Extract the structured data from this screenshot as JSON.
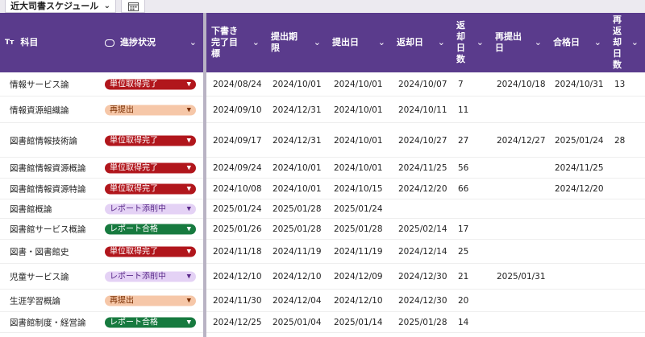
{
  "view": {
    "tab_label": "近大司書スケジュール",
    "tab_chevron": "⌄"
  },
  "colors": {
    "header_bg": "#5a3b8c",
    "status": {
      "単位取得完了": "#b1161c",
      "再提出": "#f6c7a8",
      "レポート添削中": "#e4d2f5",
      "レポート合格": "#177a3f"
    }
  },
  "columns": [
    {
      "key": "subject",
      "label": "科目",
      "icon": "text-type-icon",
      "icon_text": "Tт"
    },
    {
      "key": "status",
      "label": "進捗状況",
      "icon": "select-type-icon"
    },
    {
      "key": "target",
      "label": "下書き\n完了目\n標"
    },
    {
      "key": "deadline",
      "label": "提出期\n限"
    },
    {
      "key": "submitted",
      "label": "提出日"
    },
    {
      "key": "returned",
      "label": "返却日"
    },
    {
      "key": "return_days",
      "label": "返\n却\n日\n数"
    },
    {
      "key": "resubmit",
      "label": "再提出\n日"
    },
    {
      "key": "passed",
      "label": "合格日"
    },
    {
      "key": "re_return_days",
      "label": "再\n返\n却\n日\n数"
    }
  ],
  "rows": [
    {
      "subject": "情報サービス論",
      "status": "単位取得完了",
      "target": "2024/08/24",
      "deadline": "2024/10/01",
      "submitted": "2024/10/01",
      "returned": "2024/10/07",
      "return_days": "7",
      "resubmit": "2024/10/18",
      "passed": "2024/10/31",
      "re_return_days": "13"
    },
    {
      "subject": "情報資源組織論",
      "status": "再提出",
      "target": "2024/09/10",
      "deadline": "2024/12/31",
      "submitted": "2024/10/01",
      "returned": "2024/10/11",
      "return_days": "11",
      "resubmit": "",
      "passed": "",
      "re_return_days": ""
    },
    {
      "subject": "図書館情報技術論",
      "status": "単位取得完了",
      "target": "2024/09/17",
      "deadline": "2024/12/31",
      "submitted": "2024/10/01",
      "returned": "2024/10/27",
      "return_days": "27",
      "resubmit": "2024/12/27",
      "passed": "2025/01/24",
      "re_return_days": "28"
    },
    {
      "subject": "図書館情報資源概論",
      "status": "単位取得完了",
      "target": "2024/09/24",
      "deadline": "2024/10/01",
      "submitted": "2024/10/01",
      "returned": "2024/11/25",
      "return_days": "56",
      "resubmit": "",
      "passed": "2024/11/25",
      "re_return_days": ""
    },
    {
      "subject": "図書館情報資源特論",
      "status": "単位取得完了",
      "target": "2024/10/08",
      "deadline": "2024/10/01",
      "submitted": "2024/10/15",
      "returned": "2024/12/20",
      "return_days": "66",
      "resubmit": "",
      "passed": "2024/12/20",
      "re_return_days": ""
    },
    {
      "subject": "図書館概論",
      "status": "レポート添削中",
      "target": "2025/01/24",
      "deadline": "2025/01/28",
      "submitted": "2025/01/24",
      "returned": "",
      "return_days": "",
      "resubmit": "",
      "passed": "",
      "re_return_days": ""
    },
    {
      "subject": "図書館サービス概論",
      "status": "レポート合格",
      "target": "2025/01/26",
      "deadline": "2025/01/28",
      "submitted": "2025/01/28",
      "returned": "2025/02/14",
      "return_days": "17",
      "resubmit": "",
      "passed": "",
      "re_return_days": ""
    },
    {
      "subject": "図書・図書館史",
      "status": "単位取得完了",
      "target": "2024/11/18",
      "deadline": "2024/11/19",
      "submitted": "2024/11/19",
      "returned": "2024/12/14",
      "return_days": "25",
      "resubmit": "",
      "passed": "",
      "re_return_days": ""
    },
    {
      "subject": "児童サービス論",
      "status": "レポート添削中",
      "target": "2024/12/10",
      "deadline": "2024/12/10",
      "submitted": "2024/12/09",
      "returned": "2024/12/30",
      "return_days": "21",
      "resubmit": "2025/01/31",
      "passed": "",
      "re_return_days": ""
    },
    {
      "subject": "生涯学習概論",
      "status": "再提出",
      "target": "2024/11/30",
      "deadline": "2024/12/04",
      "submitted": "2024/12/10",
      "returned": "2024/12/30",
      "return_days": "20",
      "resubmit": "",
      "passed": "",
      "re_return_days": ""
    },
    {
      "subject": "図書館制度・経営論",
      "status": "レポート合格",
      "target": "2024/12/25",
      "deadline": "2025/01/04",
      "submitted": "2025/01/14",
      "returned": "2025/01/28",
      "return_days": "14",
      "resubmit": "",
      "passed": "",
      "re_return_days": ""
    }
  ]
}
